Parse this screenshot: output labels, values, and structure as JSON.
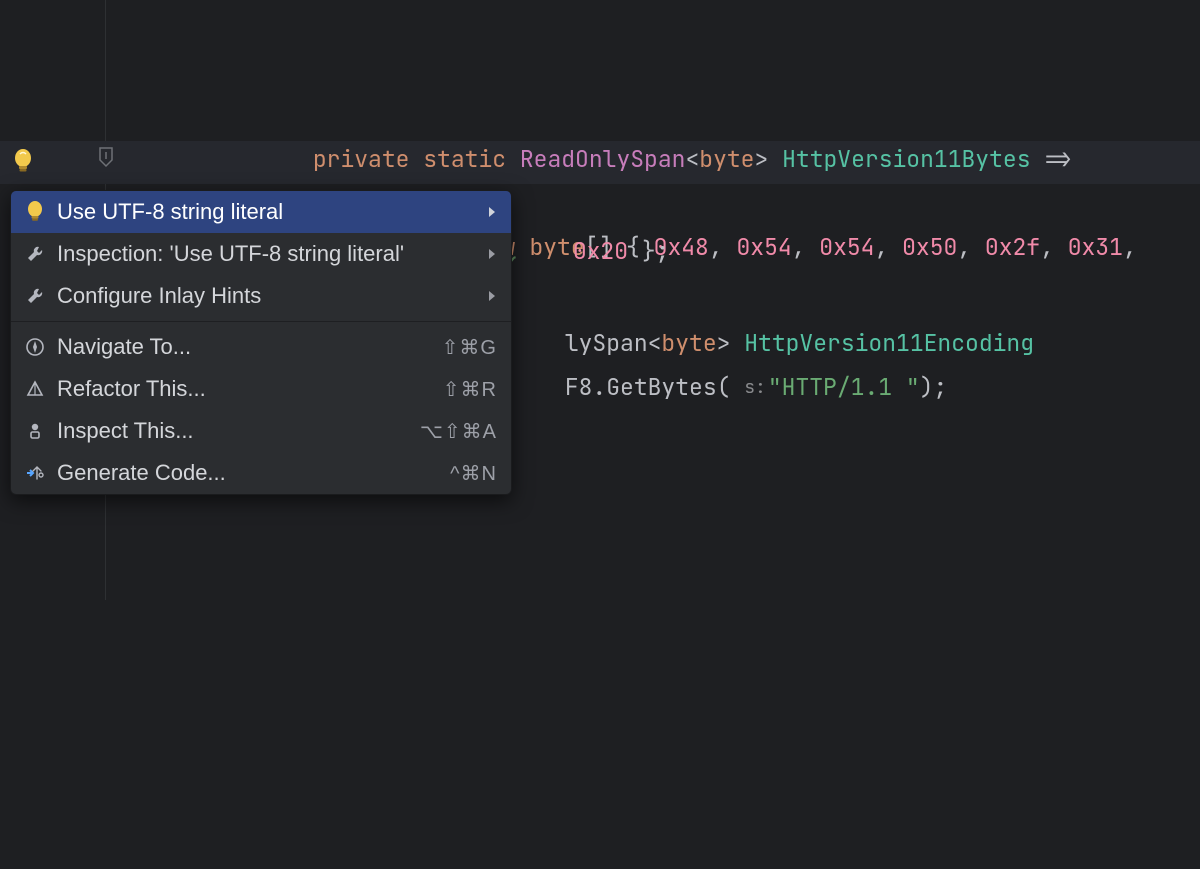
{
  "code": {
    "line1": {
      "kw1": "private",
      "kw2": "static",
      "type": "ReadOnlySpan",
      "generic": "byte",
      "name": "HttpVersion11Bytes",
      "arrow": "=>"
    },
    "line2": {
      "kw": "new",
      "type": "byte",
      "values": [
        "0x48",
        "0x54",
        "0x54",
        "0x50",
        "0x2f",
        "0x31"
      ]
    },
    "line3": {
      "trail": "0x20 };"
    },
    "line4": {
      "type": "ReadOnlySpan",
      "generic": "byte",
      "name": "HttpVersion11Encoding"
    },
    "line5": {
      "obj": "F8",
      "method": "GetBytes",
      "paramHint": "s:",
      "str": "\"HTTP/1.1 \"",
      "end": ");"
    }
  },
  "popup": {
    "items": [
      {
        "icon": "bulb",
        "label": "Use UTF-8 string literal",
        "chevron": true,
        "shortcut": "",
        "selected": true
      },
      {
        "icon": "wrench",
        "label": "Inspection: 'Use UTF-8 string literal'",
        "chevron": true,
        "shortcut": "",
        "selected": false
      },
      {
        "icon": "wrench",
        "label": "Configure Inlay Hints",
        "chevron": true,
        "shortcut": "",
        "selected": false
      }
    ],
    "items2": [
      {
        "icon": "compass",
        "label": "Navigate To...",
        "shortcut": "⇧⌘G"
      },
      {
        "icon": "prism",
        "label": "Refactor This...",
        "shortcut": "⇧⌘R"
      },
      {
        "icon": "inspect",
        "label": "Inspect This...",
        "shortcut": "⌥⇧⌘A"
      },
      {
        "icon": "generate",
        "label": "Generate Code...",
        "shortcut": "^⌘N"
      }
    ]
  }
}
